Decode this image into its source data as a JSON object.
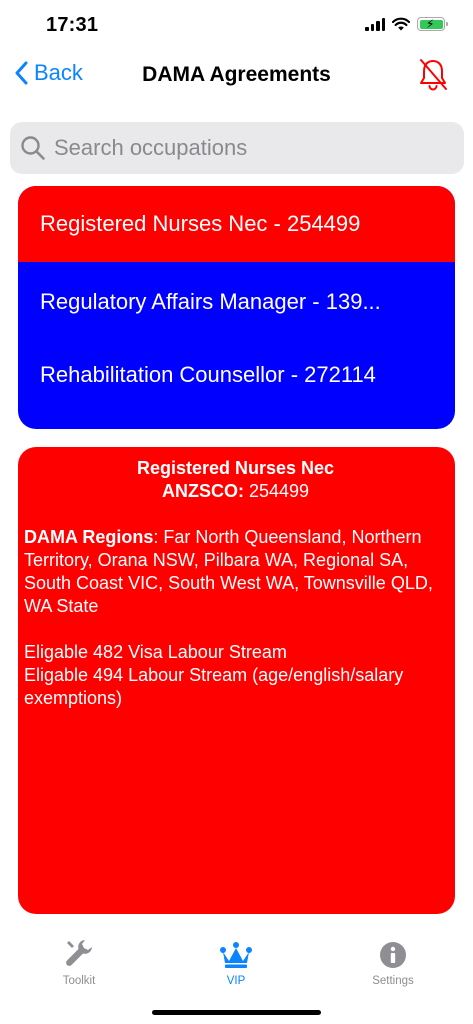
{
  "status": {
    "time": "17:31"
  },
  "nav": {
    "back_label": "Back",
    "title": "DAMA Agreements"
  },
  "search": {
    "placeholder": "Search occupations",
    "value": ""
  },
  "occupations": [
    {
      "label": "Registered Nurses Nec - 254499",
      "selected": true,
      "color": "#ff0000"
    },
    {
      "label": "Regulatory Affairs Manager - 139...",
      "selected": false,
      "color": "#0000ff"
    },
    {
      "label": "Rehabilitation Counsellor - 272114",
      "selected": false,
      "color": "#0000ff"
    }
  ],
  "detail": {
    "title": "Registered Nurses Nec",
    "anzsco_label": "ANZSCO:",
    "anzsco_value": " 254499",
    "regions_label": "DAMA Regions",
    "regions_value": ": Far North Queensland, Northern Territory, Orana NSW, Pilbara WA, Regional SA, South Coast VIC, South West WA, Townsville QLD, WA State",
    "eligibility_1": "Eligable 482 Visa Labour Stream",
    "eligibility_2": "Eligable 494 Labour Stream (age/english/salary exemptions)",
    "color": "#ff0000"
  },
  "tabs": [
    {
      "label": "Toolkit",
      "icon": "wrench-icon",
      "active": false
    },
    {
      "label": "VIP",
      "icon": "crown-icon",
      "active": true
    },
    {
      "label": "Settings",
      "icon": "info-icon",
      "active": false
    }
  ],
  "colors": {
    "accent": "#0a84ff",
    "alert": "#ff0000",
    "list_bg": "#0000ff"
  }
}
